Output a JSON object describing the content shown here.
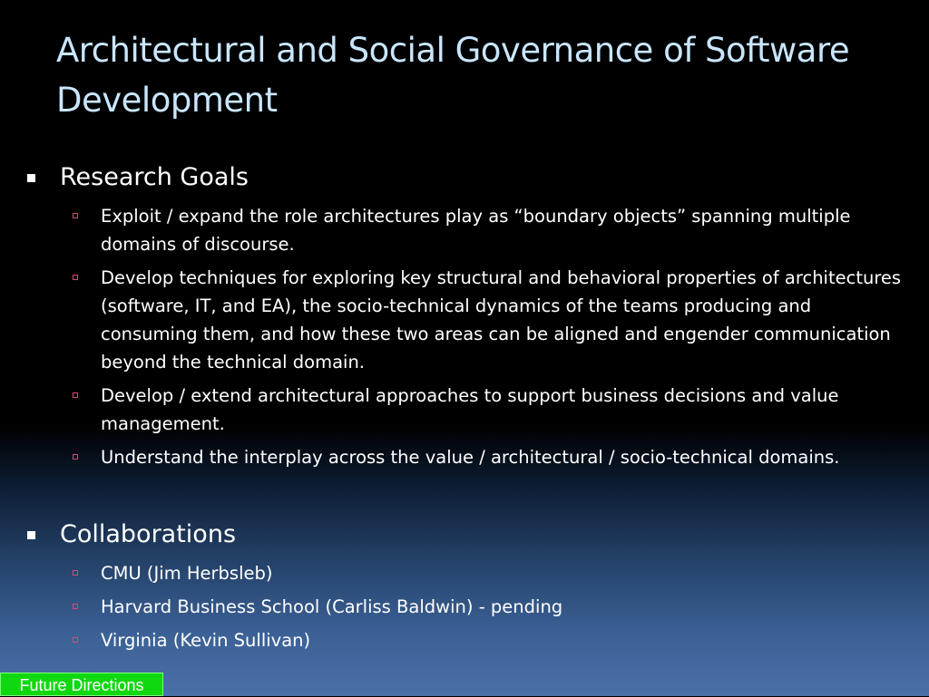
{
  "slide": {
    "title": "Architectural and Social Governance of Software Development"
  },
  "research_goals": {
    "heading": "Research Goals",
    "items": [
      "Exploit / expand the role architectures play as “boundary objects” spanning multiple domains of discourse.",
      "Develop techniques for exploring key structural and behavioral properties of architectures (software, IT, and EA), the socio-technical dynamics of the teams producing and consuming them, and how these two areas can be aligned and engender communication beyond the technical domain.",
      "Develop / extend architectural approaches to  support business decisions and value management.",
      "Understand the interplay across the value / architectural / socio-technical domains."
    ]
  },
  "collaborations": {
    "heading": "Collaborations",
    "items": [
      "CMU (Jim Herbsleb)",
      "Harvard Business School (Carliss Baldwin) - pending",
      "Virginia (Kevin Sullivan)"
    ]
  },
  "footer": {
    "button_label": "Future Directions"
  },
  "colors": {
    "title": "#c9e6ff",
    "text": "#ffffff",
    "sub_bullet": "#e0457a",
    "footer_button": "#10d810"
  }
}
